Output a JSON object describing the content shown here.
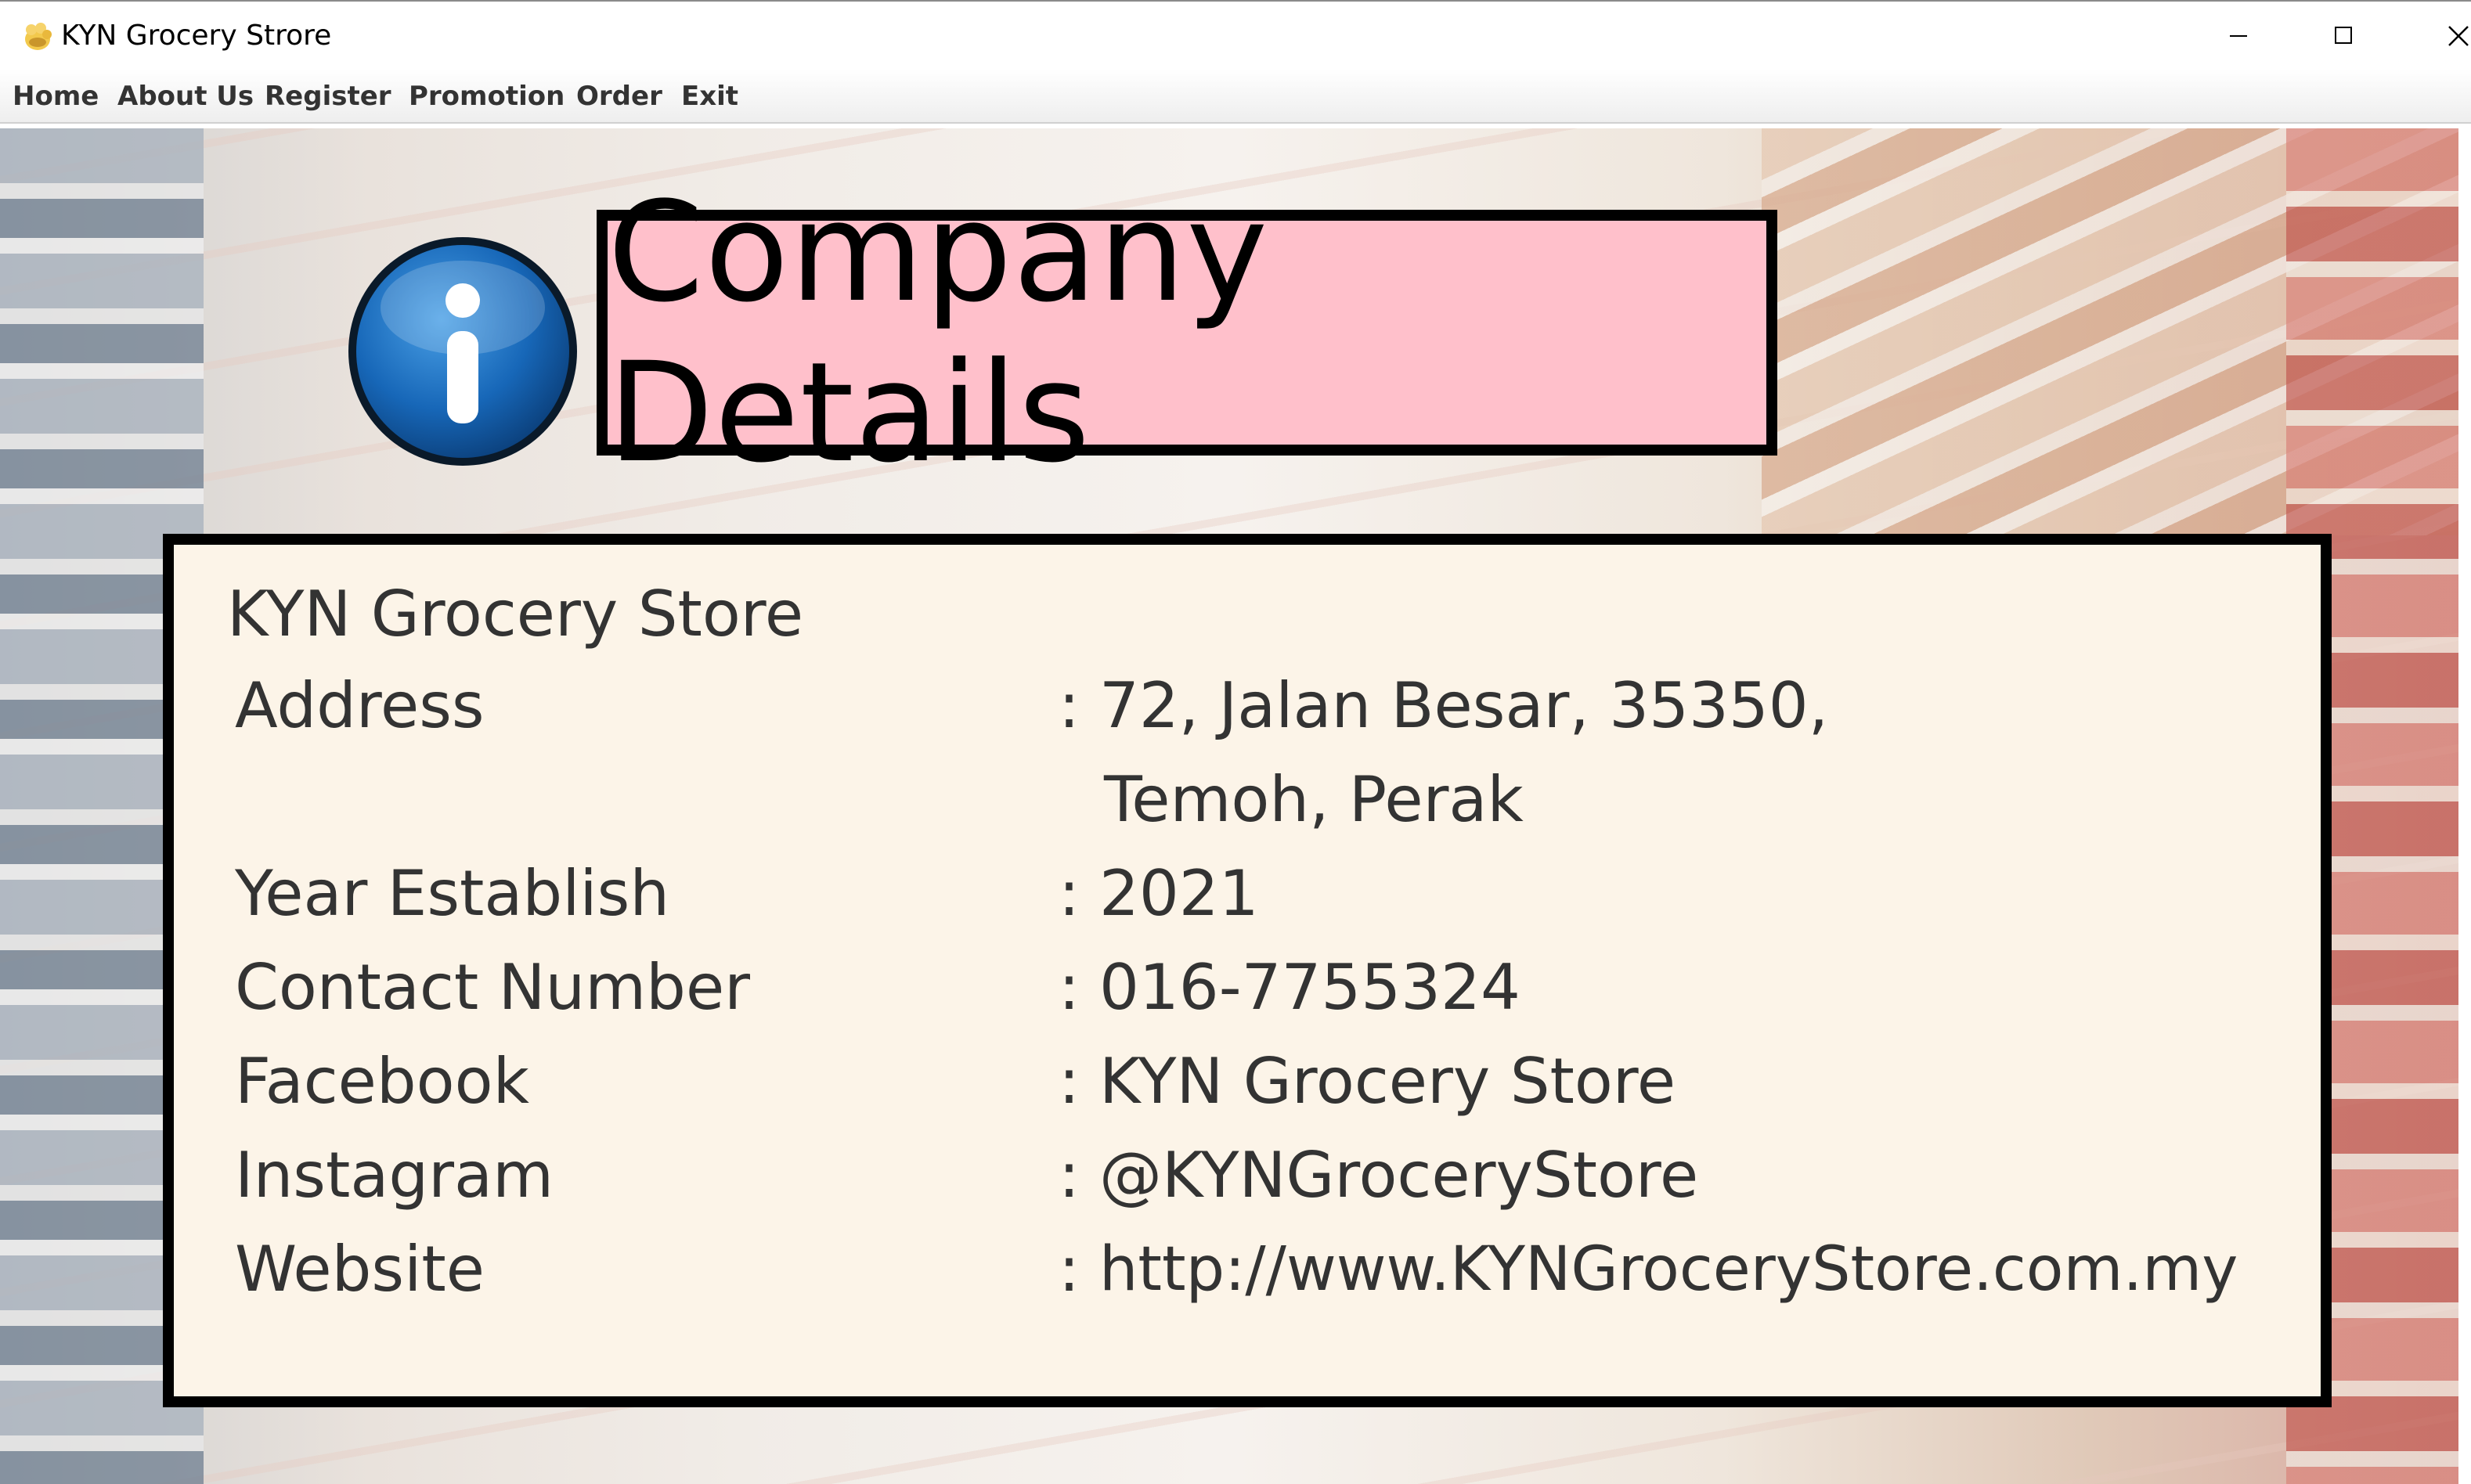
{
  "window": {
    "title": "KYN Grocery Strore",
    "icon": "app-icon"
  },
  "menu": {
    "items": [
      "Home",
      "About Us",
      "Register",
      "Promotion",
      "Order",
      "Exit"
    ]
  },
  "header": {
    "title": "Company Details",
    "icon": "info-icon",
    "background_color": "#ffc0cb"
  },
  "details": {
    "store_name": "KYN Grocery Store",
    "rows": [
      {
        "label": "Address",
        "separator": ":",
        "value": "72, Jalan Besar, 35350,"
      },
      {
        "label": "",
        "separator": "",
        "value": "Temoh, Perak"
      },
      {
        "label": "Year Establish",
        "separator": ":",
        "value": "2021"
      },
      {
        "label": "Contact Number",
        "separator": ":",
        "value": "016-7755324"
      },
      {
        "label": "Facebook",
        "separator": ":",
        "value": "KYN Grocery Store"
      },
      {
        "label": "Instagram",
        "separator": ":",
        "value": "@KYNGroceryStore"
      },
      {
        "label": "Website",
        "separator": ":",
        "value": "http://www.KYNGroceryStore.com.my"
      }
    ],
    "panel_color": "#fcf4e8"
  }
}
